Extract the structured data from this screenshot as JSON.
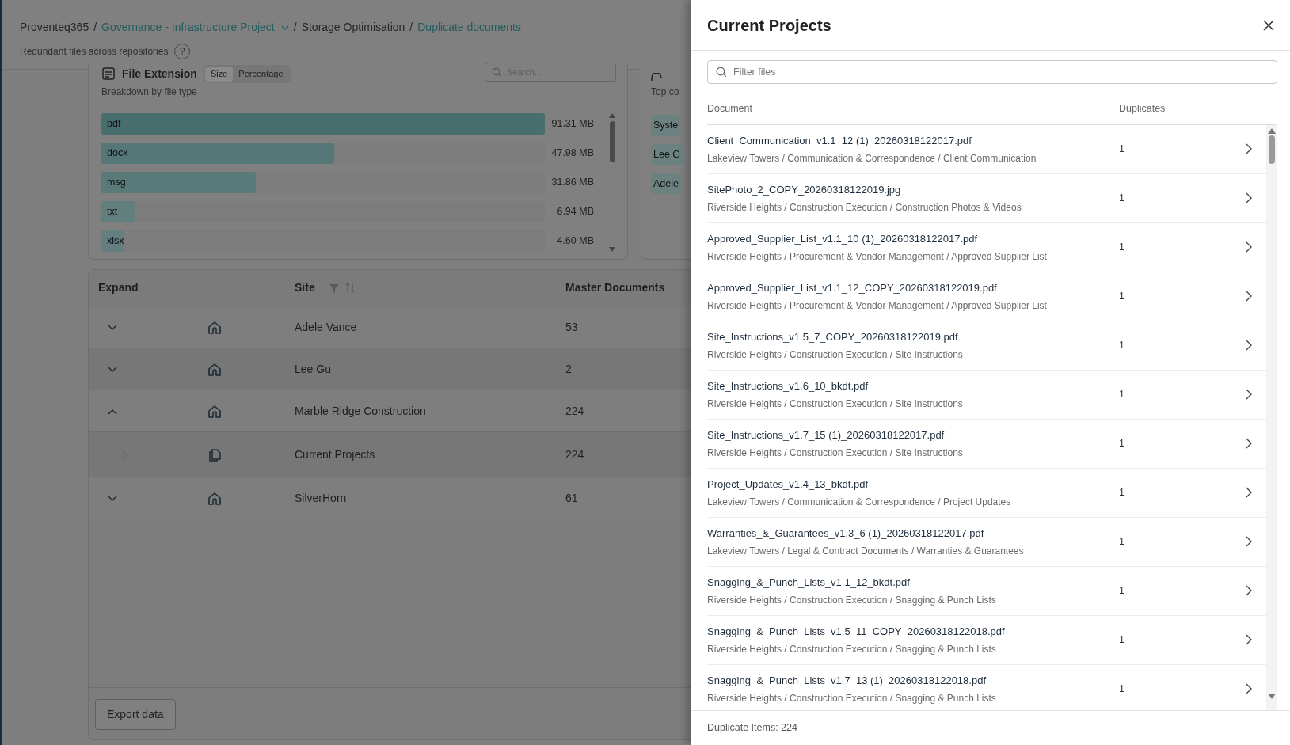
{
  "breadcrumb": [
    {
      "kind": "text",
      "label": "Proventeq365"
    },
    {
      "kind": "separator",
      "label": "/"
    },
    {
      "kind": "dropdown",
      "label": "Governance - Infrastructure Project"
    },
    {
      "kind": "separator",
      "label": "/"
    },
    {
      "kind": "text",
      "label": "Storage Optimisation"
    },
    {
      "kind": "separator",
      "label": "/"
    },
    {
      "kind": "link",
      "label": "Duplicate documents"
    }
  ],
  "subtitle": "Redundant files across repositories",
  "help": "?",
  "file_extension": {
    "title": "File Extension",
    "toggle": [
      {
        "label": "Size",
        "selected": true
      },
      {
        "label": "Percentage",
        "selected": false
      }
    ],
    "search": {
      "placeholder": "Search..."
    },
    "subtitle": "Breakdown by file type",
    "bars": [
      {
        "label": "pdf",
        "value": "91.31 MB",
        "level": 1.0
      },
      {
        "label": "docx",
        "value": "47.98 MB",
        "level": 0.525
      },
      {
        "label": "msg",
        "value": "31.86 MB",
        "level": 0.348
      },
      {
        "label": "txt",
        "value": "6.94 MB",
        "level": 0.076
      },
      {
        "label": "xlsx",
        "value": "4.60 MB",
        "level": 0.05
      }
    ]
  },
  "contributors": {
    "subtitle": "Top co",
    "chips": [
      "Syste",
      "Lee G",
      "Adele"
    ]
  },
  "table": {
    "columns": [
      "Expand",
      "Site",
      "Master Documents"
    ],
    "rows": [
      {
        "kind": "site",
        "site": "Adele Vance",
        "master": "53",
        "expanded": false
      },
      {
        "kind": "site",
        "site": "Lee Gu",
        "master": "2",
        "expanded": false
      },
      {
        "kind": "site",
        "site": "Marble Ridge Construction",
        "master": "224",
        "expanded": true,
        "children": [
          {
            "kind": "folder",
            "site": "Current Projects",
            "master": "224"
          }
        ]
      },
      {
        "kind": "site",
        "site": "SilverHorn",
        "master": "61",
        "expanded": false
      }
    ]
  },
  "export_button": "Export data",
  "drawer": {
    "title": "Current Projects",
    "filter": {
      "placeholder": "Filter files"
    },
    "columns": [
      "Document",
      "Duplicates"
    ],
    "rows": [
      {
        "name": "Client_Communication_v1.1_12 (1)_20260318122017.pdf",
        "path": "Lakeview Towers / Communication & Correspondence / Client Communication",
        "duplicates": "1"
      },
      {
        "name": "SitePhoto_2_COPY_20260318122019.jpg",
        "path": "Riverside Heights / Construction Execution / Construction Photos & Videos",
        "duplicates": "1"
      },
      {
        "name": "Approved_Supplier_List_v1.1_10 (1)_20260318122017.pdf",
        "path": "Riverside Heights / Procurement & Vendor Management / Approved Supplier List",
        "duplicates": "1"
      },
      {
        "name": "Approved_Supplier_List_v1.1_12_COPY_20260318122019.pdf",
        "path": "Riverside Heights / Procurement & Vendor Management / Approved Supplier List",
        "duplicates": "1"
      },
      {
        "name": "Site_Instructions_v1.5_7_COPY_20260318122019.pdf",
        "path": "Riverside Heights / Construction Execution / Site Instructions",
        "duplicates": "1"
      },
      {
        "name": "Site_Instructions_v1.6_10_bkdt.pdf",
        "path": "Riverside Heights / Construction Execution / Site Instructions",
        "duplicates": "1"
      },
      {
        "name": "Site_Instructions_v1.7_15 (1)_20260318122017.pdf",
        "path": "Riverside Heights / Construction Execution / Site Instructions",
        "duplicates": "1"
      },
      {
        "name": "Project_Updates_v1.4_13_bkdt.pdf",
        "path": "Lakeview Towers / Communication & Correspondence / Project Updates",
        "duplicates": "1"
      },
      {
        "name": "Warranties_&_Guarantees_v1.3_6 (1)_20260318122017.pdf",
        "path": "Lakeview Towers / Legal & Contract Documents / Warranties & Guarantees",
        "duplicates": "1"
      },
      {
        "name": "Snagging_&_Punch_Lists_v1.1_12_bkdt.pdf",
        "path": "Riverside Heights / Construction Execution / Snagging & Punch Lists",
        "duplicates": "1"
      },
      {
        "name": "Snagging_&_Punch_Lists_v1.5_11_COPY_20260318122018.pdf",
        "path": "Riverside Heights / Construction Execution / Snagging & Punch Lists",
        "duplicates": "1"
      },
      {
        "name": "Snagging_&_Punch_Lists_v1.7_13 (1)_20260318122018.pdf",
        "path": "Riverside Heights / Construction Execution / Snagging & Punch Lists",
        "duplicates": "1"
      }
    ],
    "footer": "Duplicate Items: 224"
  }
}
